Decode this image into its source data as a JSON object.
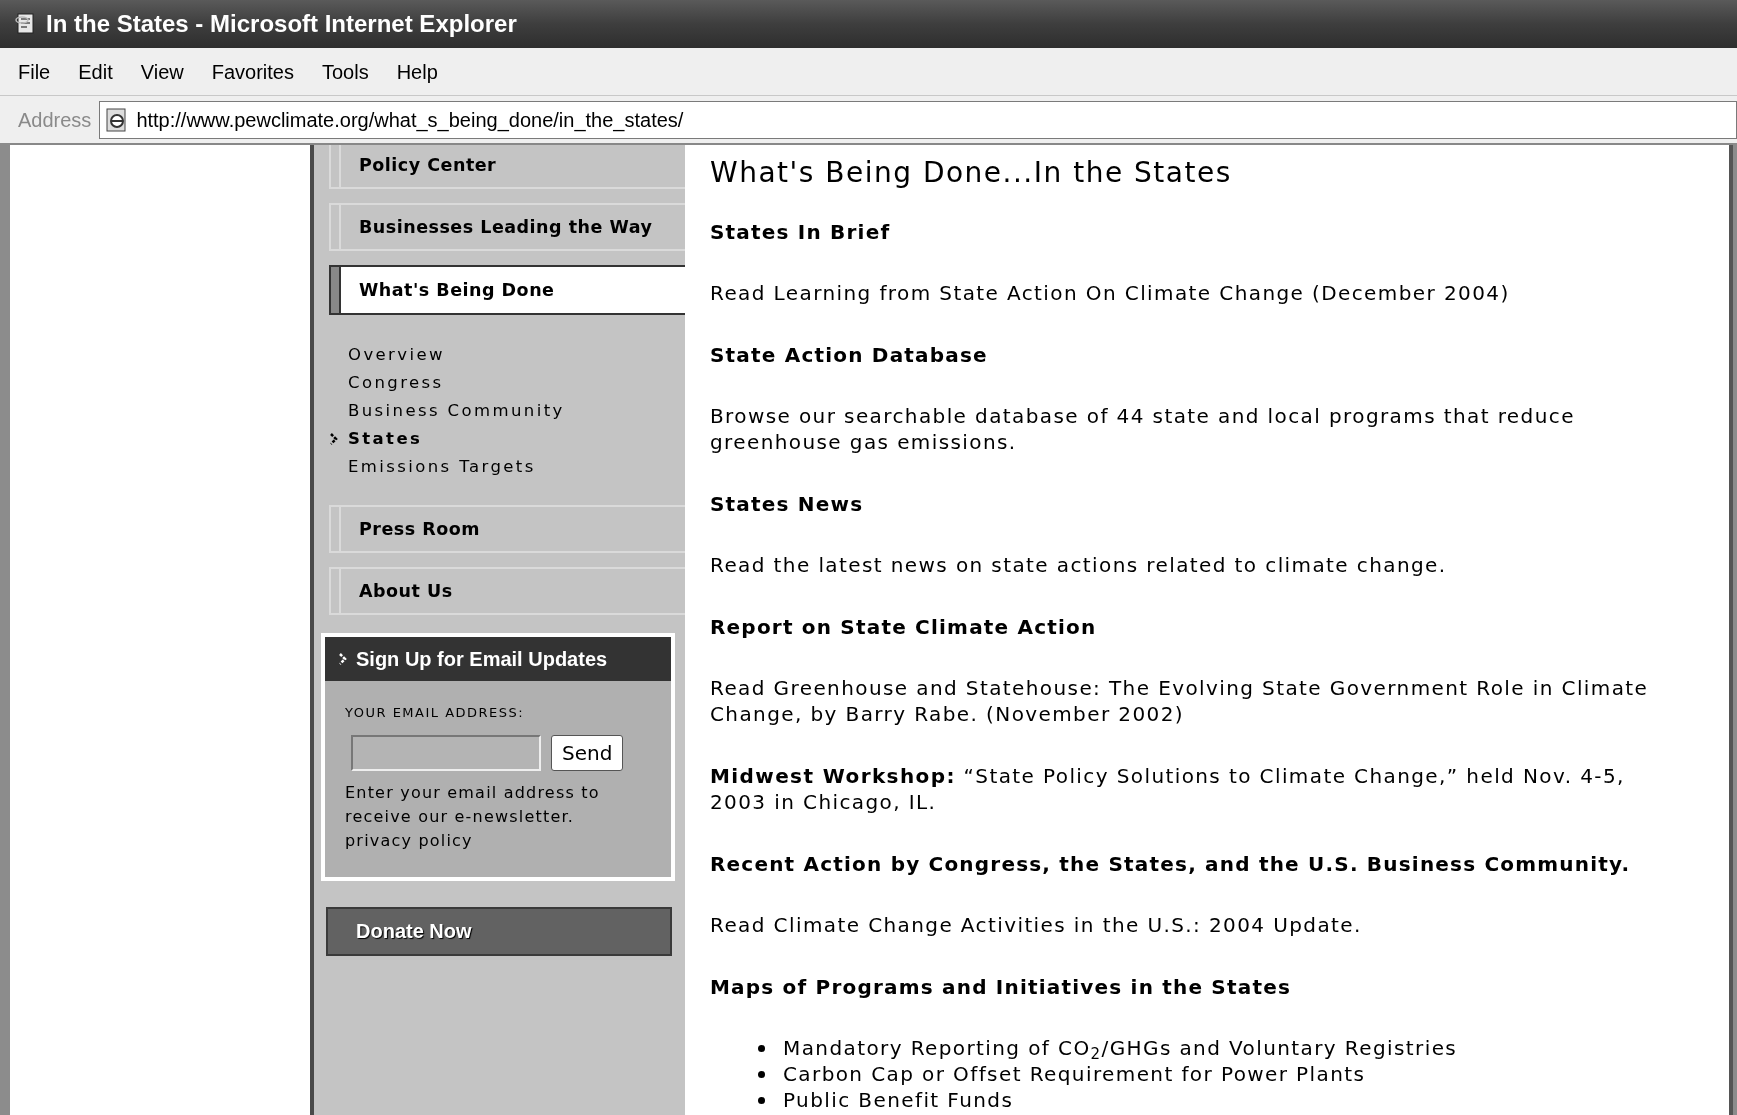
{
  "window": {
    "title": "In the States - Microsoft Internet Explorer"
  },
  "menu": [
    "File",
    "Edit",
    "View",
    "Favorites",
    "Tools",
    "Help"
  ],
  "address_bar": {
    "label": "Address",
    "url": "http://www.pewclimate.org/what_s_being_done/in_the_states/"
  },
  "sidebar": {
    "nav": [
      {
        "label": "Policy Center",
        "selected": false
      },
      {
        "label": "Businesses Leading the Way",
        "selected": false
      },
      {
        "label": "What's Being Done",
        "selected": true,
        "children": [
          {
            "label": "Overview",
            "selected": false
          },
          {
            "label": "Congress",
            "selected": false
          },
          {
            "label": "Business Community",
            "selected": false
          },
          {
            "label": "States",
            "selected": true
          },
          {
            "label": "Emissions Targets",
            "selected": false
          }
        ]
      },
      {
        "label": "Press Room",
        "selected": false
      },
      {
        "label": "About Us",
        "selected": false
      }
    ],
    "email_signup": {
      "title": "Sign Up for Email Updates",
      "field_label": "YOUR EMAIL ADDRESS:",
      "button": "Send",
      "description": "Enter your email address to receive our e-newsletter.",
      "link": "privacy policy"
    },
    "donate_button": "Donate Now"
  },
  "main": {
    "title": "What's Being Done...In the States",
    "sections": [
      {
        "kind": "heading",
        "text": "States In Brief"
      },
      {
        "kind": "paragraph",
        "text": "Read Learning from State Action On Climate Change (December 2004)"
      },
      {
        "kind": "heading",
        "text": "State Action Database"
      },
      {
        "kind": "paragraph",
        "text": "Browse our searchable database of 44 state and local programs that reduce greenhouse gas emissions."
      },
      {
        "kind": "heading",
        "text": "States News"
      },
      {
        "kind": "paragraph",
        "text": "Read the latest news on state actions related to climate change."
      },
      {
        "kind": "heading",
        "text": "Report on State Climate Action"
      },
      {
        "kind": "paragraph",
        "text": "Read Greenhouse and Statehouse: The Evolving State Government Role in Climate Change, by Barry Rabe. (November 2002)"
      },
      {
        "kind": "paragraph",
        "text": "**Midwest Workshop:** “State Policy Solutions to Climate Change,” held Nov. 4-5, 2003 in Chicago, IL."
      },
      {
        "kind": "heading",
        "text": "Recent Action by Congress, the States, and the U.S. Business Community."
      },
      {
        "kind": "paragraph",
        "text": "Read Climate Change Activities in the U.S.: 2004 Update."
      },
      {
        "kind": "heading",
        "text": "Maps of Programs and Initiatives in the States"
      },
      {
        "kind": "bullets",
        "items": [
          "Mandatory Reporting of CO$_{2}$/GHGs and Voluntary Registries",
          "Carbon Cap or Offset Requirement for Power Plants",
          "Public Benefit Funds"
        ]
      }
    ]
  }
}
